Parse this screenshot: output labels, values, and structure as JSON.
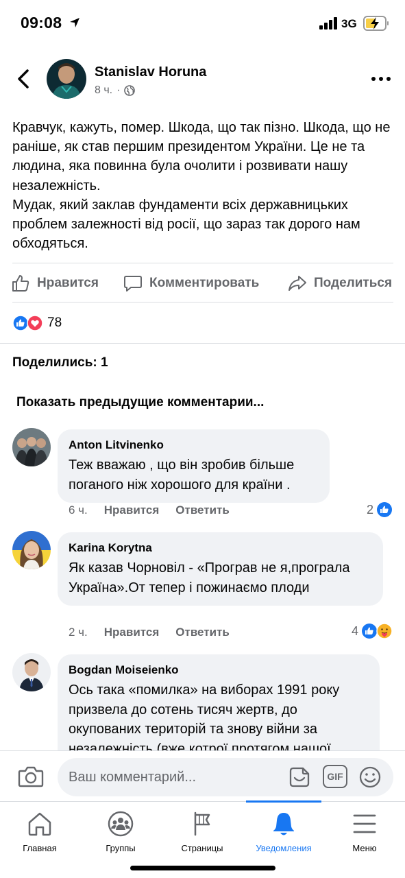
{
  "status": {
    "time": "09:08",
    "network": "3G"
  },
  "post": {
    "author": "Stanislav Horuna",
    "time": "8 ч.",
    "separator": "·",
    "paragraphs": [
      "Кравчук, кажуть, помер. Шкода, що так пізно. Шкода, що не раніше, як став першим президентом України. Це не та людина, яка повинна була очолити і розвивати нашу незалежність.",
      "Мудак, який заклав фундаменти всіх державницьких проблем залежності від росії, що зараз так дорого нам обходяться."
    ]
  },
  "actions": {
    "like": "Нравится",
    "comment": "Комментировать",
    "share": "Поделиться"
  },
  "reactions": {
    "count": "78"
  },
  "shares_text": "Поделились: 1",
  "prev_comments": "Показать предыдущие комментарии...",
  "comments": [
    {
      "author": "Anton Litvinenko",
      "text": "Теж вважаю , що він зробив більше поганого ніж хорошого для країни .",
      "time": "6 ч.",
      "like": "Нравится",
      "reply": "Ответить",
      "reactions": "2"
    },
    {
      "author": "Karina Korytna",
      "text": "Як казав Чорновіл - «Програв не я,програла Україна».От тепер і пожинаємо плоди",
      "time": "2 ч.",
      "like": "Нравится",
      "reply": "Ответить",
      "reactions": "4"
    },
    {
      "author": "Bogdan Moiseienko",
      "text": "Ось така «помилка» на виборах 1991 року призвела до сотень тисяч жертв, до окупованих територій та знову війни за незалежність (вже котрої протягом нашої"
    }
  ],
  "composer": {
    "placeholder": "Ваш комментарий...",
    "gif": "GIF"
  },
  "tabs": [
    {
      "label": "Главная",
      "icon": "home-icon"
    },
    {
      "label": "Группы",
      "icon": "groups-icon"
    },
    {
      "label": "Страницы",
      "icon": "flag-icon"
    },
    {
      "label": "Уведомления",
      "icon": "bell-icon"
    },
    {
      "label": "Меню",
      "icon": "menu-icon"
    }
  ],
  "colors": {
    "accent": "#1877f2",
    "secondary_text": "#65676b",
    "bubble": "#f0f2f5",
    "love": "#f33e58"
  }
}
